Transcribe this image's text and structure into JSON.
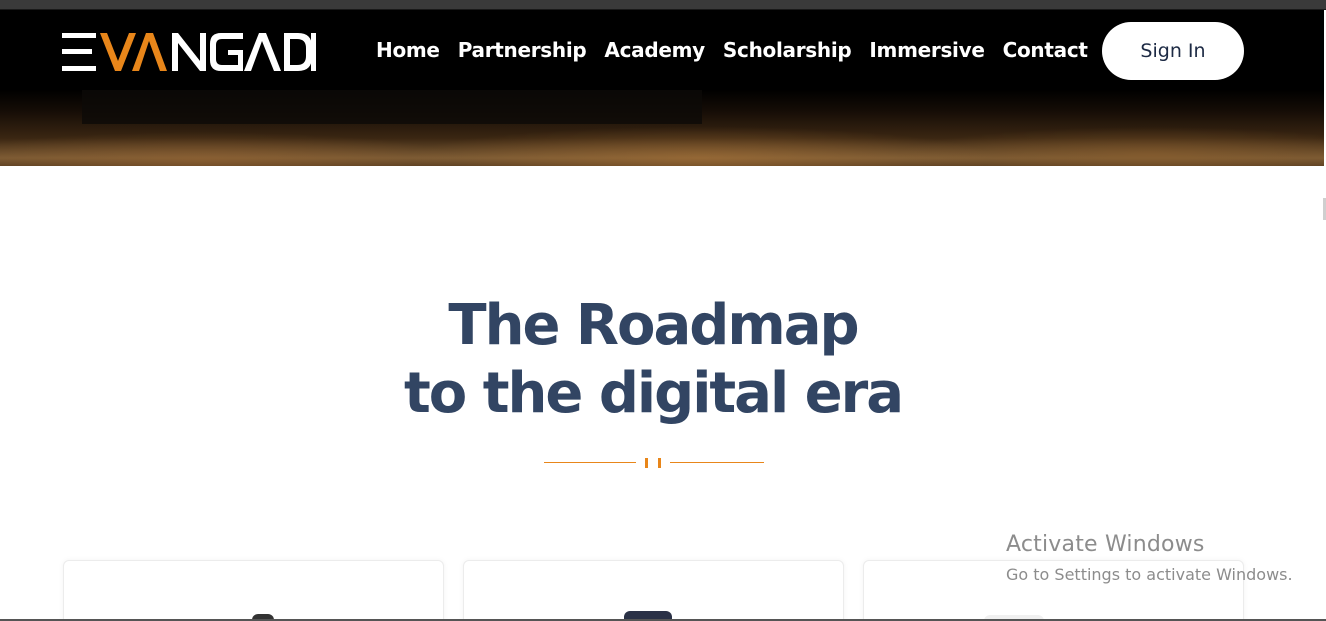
{
  "brand": {
    "name": "EVANGADI",
    "accent_color": "#e8861a",
    "primary_text_color": "#324563"
  },
  "nav": {
    "items": [
      {
        "label": "Home"
      },
      {
        "label": "Partnership"
      },
      {
        "label": "Academy"
      },
      {
        "label": "Scholarship"
      },
      {
        "label": "Immersive"
      },
      {
        "label": "Contact"
      }
    ],
    "signin_label": "Sign In"
  },
  "section": {
    "title_line1": "The Roadmap",
    "title_line2": "to the digital era"
  },
  "watermark": {
    "line1": "Activate Windows",
    "line2": "Go to Settings to activate Windows."
  }
}
